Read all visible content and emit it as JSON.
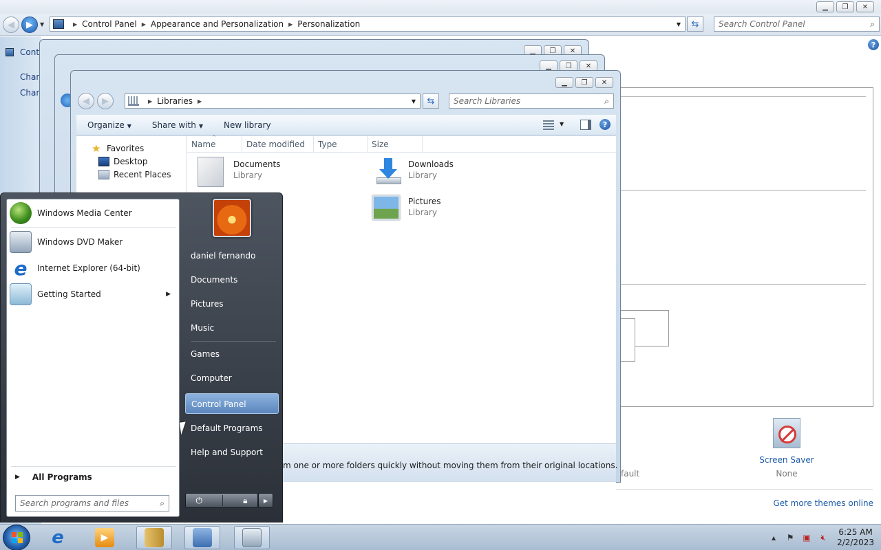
{
  "control_panel": {
    "breadcrumb": [
      "Control Panel",
      "Appearance and Personalization",
      "Personalization"
    ],
    "search_placeholder": "Search Control Panel",
    "left_items": [
      "Control Panel Home",
      "Change desktop icons",
      "Change mouse pointers"
    ],
    "left_title": "Control Panel Home",
    "description_fragment": "m one or more folders quickly without moving them from their original locations.",
    "default_fragment": "fault",
    "screen_saver_label": "Screen Saver",
    "screen_saver_value": "None",
    "more_themes_link": "Get more themes online"
  },
  "libraries_window": {
    "breadcrumb": [
      "Libraries"
    ],
    "search_placeholder": "Search Libraries",
    "toolbar": {
      "organize": "Organize",
      "share_with": "Share with",
      "new_library": "New library"
    },
    "nav_tree": {
      "favorites": "Favorites",
      "items": [
        "Desktop",
        "Recent Places"
      ]
    },
    "columns": [
      "Name",
      "Date modified",
      "Type",
      "Size"
    ],
    "libraries": [
      {
        "name": "Documents",
        "type": "Library"
      },
      {
        "name": "Downloads",
        "type": "Library"
      },
      {
        "name": "Pictures",
        "type": "Library"
      }
    ]
  },
  "start_menu": {
    "programs": [
      {
        "label": "Windows Media Center",
        "icon": "media-center-icon"
      },
      {
        "label": "Windows DVD Maker",
        "icon": "dvd-maker-icon"
      },
      {
        "label": "Internet Explorer (64-bit)",
        "icon": "internet-explorer-icon"
      },
      {
        "label": "Getting Started",
        "icon": "getting-started-icon"
      }
    ],
    "all_programs": "All Programs",
    "search_placeholder": "Search programs and files",
    "user_name": "daniel fernando",
    "right_items": [
      "Documents",
      "Pictures",
      "Music",
      "Games",
      "Computer",
      "Control Panel",
      "Default Programs",
      "Help and Support"
    ],
    "selected_item": "Control Panel"
  },
  "taskbar": {
    "time": "6:25 AM",
    "date": "2/2/2023"
  },
  "colors": {
    "accent": "#1e5ca8",
    "selection": "#5b86bd"
  }
}
